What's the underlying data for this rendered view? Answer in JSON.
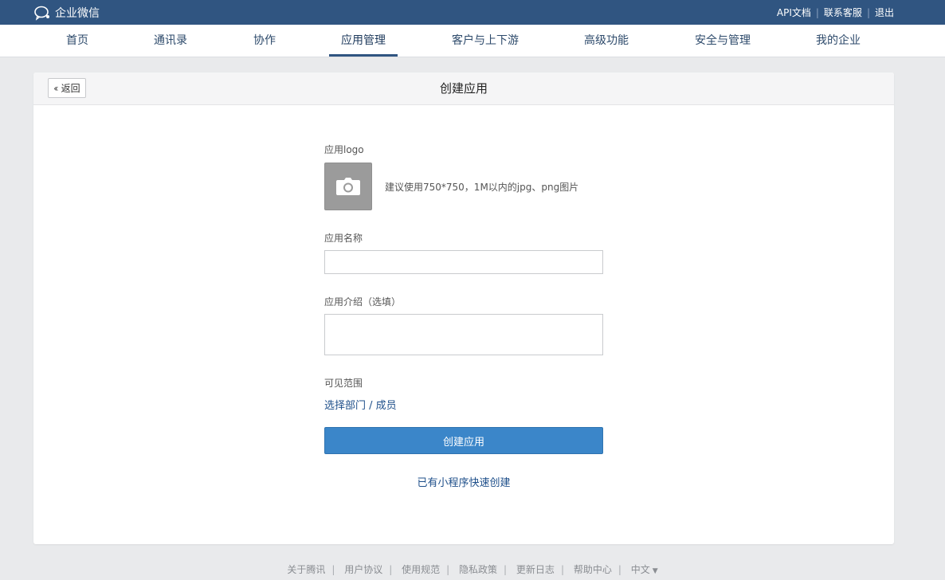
{
  "brand": {
    "name": "企业微信"
  },
  "toplinks": [
    "API文档",
    "联系客服",
    "退出"
  ],
  "nav": {
    "items": [
      "首页",
      "通讯录",
      "协作",
      "应用管理",
      "客户与上下游",
      "高级功能",
      "安全与管理",
      "我的企业"
    ],
    "active": "应用管理"
  },
  "panel": {
    "back_label": "返回",
    "title": "创建应用"
  },
  "form": {
    "logo_label": "应用logo",
    "logo_hint": "建议使用750*750，1M以内的jpg、png图片",
    "name_label": "应用名称",
    "name_value": "",
    "intro_label": "应用介绍（选填）",
    "intro_value": "",
    "scope_label": "可见范围",
    "scope_link": "选择部门 / 成员",
    "submit_label": "创建应用",
    "mini_link": "已有小程序快速创建"
  },
  "footer": {
    "links": [
      "关于腾讯",
      "用户协议",
      "使用规范",
      "隐私政策",
      "更新日志",
      "帮助中心"
    ],
    "language": "中文"
  },
  "colors": {
    "topbar": "#305581",
    "primary": "#3b86c9",
    "link": "#1e4f8a"
  }
}
